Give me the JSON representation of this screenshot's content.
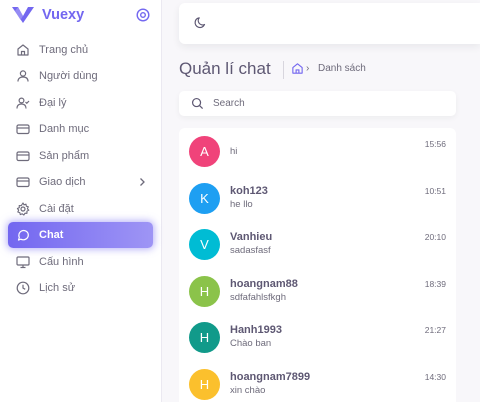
{
  "brand": {
    "name": "Vuexy",
    "color": "#7367f0"
  },
  "sidebar": {
    "items": [
      {
        "label": "Trang chủ",
        "icon": "home-icon"
      },
      {
        "label": "Người dùng",
        "icon": "user-icon"
      },
      {
        "label": "Đại lý",
        "icon": "user-check-icon"
      },
      {
        "label": "Danh mục",
        "icon": "credit-card-icon"
      },
      {
        "label": "Sản phẩm",
        "icon": "credit-card-icon"
      },
      {
        "label": "Giao dịch",
        "icon": "credit-card-icon",
        "has_submenu": true
      },
      {
        "label": "Cài đặt",
        "icon": "gear-icon"
      },
      {
        "label": "Chat",
        "icon": "message-circle-icon",
        "active": true
      },
      {
        "label": "Cấu hình",
        "icon": "monitor-icon"
      },
      {
        "label": "Lịch sử",
        "icon": "clock-icon"
      }
    ]
  },
  "header": {
    "title": "Quản lí chat",
    "breadcrumb": {
      "home_icon": "home-icon",
      "separator": "›",
      "current": "Danh sách"
    }
  },
  "search": {
    "placeholder": "Search",
    "value": ""
  },
  "chats": [
    {
      "initial": "A",
      "name": "",
      "message": "hi",
      "time": "15:56",
      "color": "#f0437a"
    },
    {
      "initial": "K",
      "name": "koh123",
      "message": "he llo",
      "time": "10:51",
      "color": "#1e9ff2"
    },
    {
      "initial": "V",
      "name": "Vanhieu",
      "message": "sadasfasf",
      "time": "20:10",
      "color": "#00bcd4"
    },
    {
      "initial": "H",
      "name": "hoangnam88",
      "message": "sdfafahlsfkgh",
      "time": "18:39",
      "color": "#8bc34a"
    },
    {
      "initial": "H",
      "name": "Hanh1993",
      "message": "Chào ban",
      "time": "21:27",
      "color": "#119a8a"
    },
    {
      "initial": "H",
      "name": "hoangnam7899",
      "message": "xin chào",
      "time": "14:30",
      "color": "#fbc02d"
    }
  ]
}
